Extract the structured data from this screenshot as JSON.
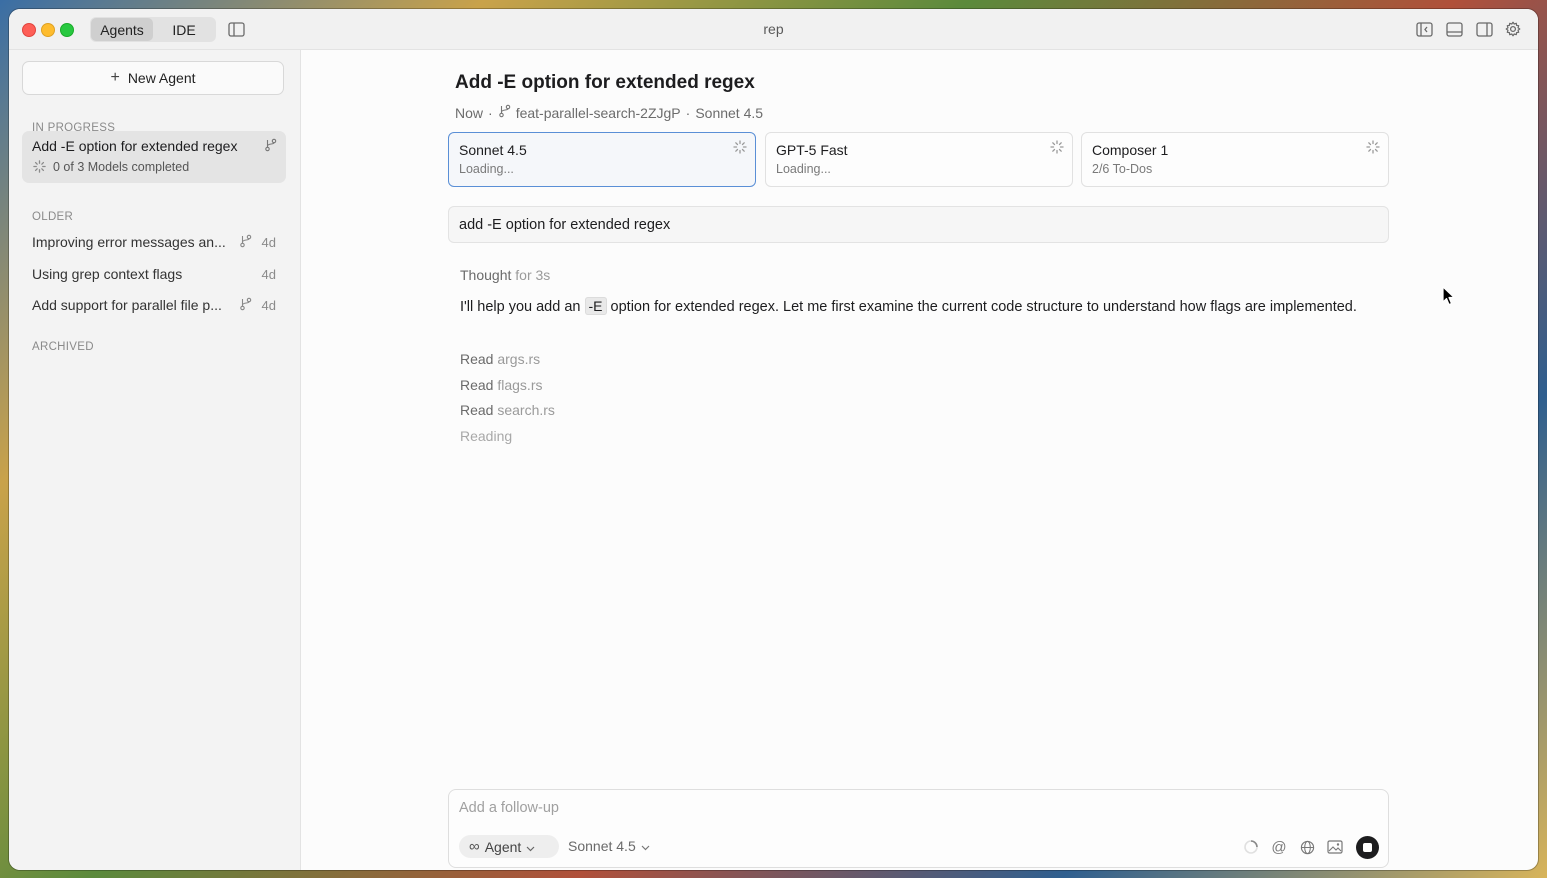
{
  "window": {
    "title": "rep"
  },
  "toolbar": {
    "tabs": [
      {
        "label": "Agents",
        "active": true
      },
      {
        "label": "IDE",
        "active": false
      }
    ]
  },
  "sidebar": {
    "new_agent_label": "New Agent",
    "in_progress_header": "IN PROGRESS",
    "active_item": {
      "title": "Add -E option for extended regex",
      "status": "0 of 3 Models completed"
    },
    "older_header": "OLDER",
    "older_items": [
      {
        "title": "Improving error messages an...",
        "age": "4d",
        "has_branch": true
      },
      {
        "title": "Using grep context flags",
        "age": "4d",
        "has_branch": false
      },
      {
        "title": "Add support for parallel file p...",
        "age": "4d",
        "has_branch": true
      }
    ],
    "archived_header": "ARCHIVED"
  },
  "main": {
    "title": "Add -E option for extended regex",
    "meta": {
      "time": "Now",
      "sep1": "·",
      "branch": "feat-parallel-search-2ZJgP",
      "sep2": "·",
      "model": "Sonnet 4.5"
    },
    "model_cards": [
      {
        "name": "Sonnet 4.5",
        "status": "Loading...",
        "selected": true
      },
      {
        "name": "GPT-5 Fast",
        "status": "Loading...",
        "selected": false
      },
      {
        "name": "Composer 1",
        "status": "2/6 To-Dos",
        "selected": false
      }
    ],
    "user_prompt": "add -E option for extended regex",
    "thought": {
      "label": "Thought",
      "duration": "for 3s"
    },
    "response": {
      "before": "I'll help you add an",
      "code": "-E",
      "after": "option for extended regex. Let me first examine the current code structure to understand how flags are implemented."
    },
    "reads": [
      {
        "verb": "Read",
        "file": "args.rs"
      },
      {
        "verb": "Read",
        "file": "flags.rs"
      },
      {
        "verb": "Read",
        "file": "search.rs"
      }
    ],
    "reading_label": "Reading"
  },
  "composer": {
    "placeholder": "Add a follow-up",
    "mode": "Agent",
    "model": "Sonnet 4.5"
  },
  "colors": {
    "accent": "#5a8fd6",
    "active_item_bg": "#e4e4e4",
    "close": "#fe5f57",
    "minimize": "#febc2e",
    "maximize": "#28c840"
  }
}
